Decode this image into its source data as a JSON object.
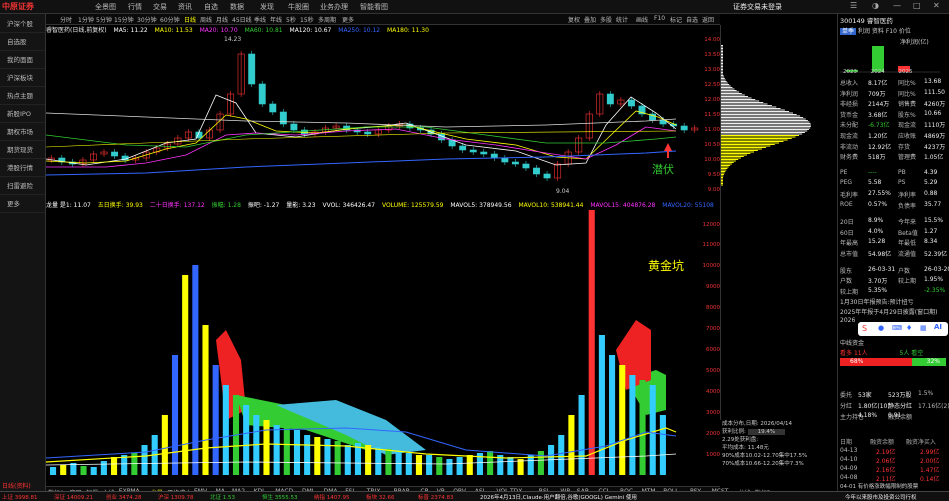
{
  "menubar": {
    "logo": "中原证券",
    "items": [
      "全景图",
      "行情",
      "交易",
      "资讯",
      "自选",
      "数据",
      "发现",
      "牛股圈",
      "业务办理",
      "智能看图"
    ],
    "right_text": "证券交易未登录"
  },
  "sidebar": {
    "items": [
      "沪深个股",
      "自选股",
      "我的面面",
      "沪深板块",
      "热点主题",
      "新股IPO",
      "期权市场",
      "期货现货",
      "港股行情",
      "扫雷避险",
      "更多"
    ]
  },
  "periods": {
    "items": [
      "分时",
      "1分钟",
      "5分钟",
      "15分钟",
      "30分钟",
      "60分钟",
      "日线",
      "周线",
      "月线",
      "45日线",
      "季线",
      "年线",
      "5秒",
      "15秒",
      "多周期",
      "更多"
    ],
    "active": "日线",
    "right": [
      "复权",
      "叠加",
      "多股",
      "统计",
      "画线",
      "F10",
      "标记",
      "自选",
      "返回"
    ]
  },
  "ma_line": {
    "name": "睿智医药(日线,前复权)",
    "items": [
      {
        "t": "MA5: 11.22",
        "c": "#fff"
      },
      {
        "t": "MA10: 11.53",
        "c": "#ff0"
      },
      {
        "t": "MA20: 10.70",
        "c": "#f3f"
      },
      {
        "t": "MA60: 10.81",
        "c": "#3c3"
      },
      {
        "t": "MA120: 10.67",
        "c": "#fff"
      },
      {
        "t": "MA250: 10.12",
        "c": "#36f"
      },
      {
        "t": "MA180: 11.30",
        "c": "#ff0"
      }
    ]
  },
  "chart_labels": {
    "high": "14.23",
    "low": "9.04",
    "tag": "潜伏",
    "tag2": "黄金坑"
  },
  "yaxis": [
    "14.00",
    "13.50",
    "13.00",
    "12.50",
    "12.00",
    "11.50",
    "11.00",
    "10.50",
    "10.00",
    "9.50",
    "9.00"
  ],
  "vol_line": {
    "items": [
      {
        "t": "龙量 是1: 11.07",
        "c": "#fff"
      },
      {
        "t": "五日换手: 39.93",
        "c": "#ff0"
      },
      {
        "t": "二十日换手: 137.12",
        "c": "#f3f"
      },
      {
        "t": "振幅: 1.28",
        "c": "#3c3"
      },
      {
        "t": "振吧: -1.27",
        "c": "#fff"
      },
      {
        "t": "量能: 3.23",
        "c": "#fff"
      },
      {
        "t": "VVOL: 346426.47",
        "c": "#fff"
      },
      {
        "t": "VOLUME: 125579.59",
        "c": "#ff0"
      },
      {
        "t": "MAVOL5: 378949.56",
        "c": "#fff"
      },
      {
        "t": "MAVOL10: 538941.44",
        "c": "#ff0"
      },
      {
        "t": "MAVOL15: 404876.28",
        "c": "#f3f"
      },
      {
        "t": "MAVOL20: 55108",
        "c": "#36f"
      }
    ]
  },
  "vyaxis": [
    "12000",
    "11000",
    "10000",
    "9000",
    "8000",
    "7000",
    "6000",
    "5000",
    "4000",
    "3000",
    "2000",
    "1000"
  ],
  "ind_tabs": [
    "指标A",
    "窗口",
    "起爆",
    "主线",
    "EXPMA",
    "龙量",
    "平均成本",
    "EMV",
    "MA",
    "MA2",
    "KDJ",
    "MACD",
    "DMI",
    "DMA",
    "FSL",
    "TRIX",
    "BRAR",
    "CR",
    "VR",
    "OBV",
    "ASI",
    "VOL-TDX",
    "RSI",
    "WR",
    "SAR",
    "CCI",
    "ROC",
    "MTM",
    "BOLL",
    "PSY",
    "MCST",
    "龙线",
    "指标B"
  ],
  "dist_info": {
    "title": "成本分布,日期: 2026/04/14",
    "profit": "获利比例:",
    "profit_val": "19.4%",
    "ratio": "2.29处获利盘:",
    "avg": "平均成本: 11.48元",
    "r90": "90%成本10.02-12.70集中17.5%",
    "r70": "70%成本10.66-12.20集中7.3%"
  },
  "quote": {
    "code": "300149",
    "name": "睿智医药",
    "tabs": [
      "单季",
      "利润",
      "资料",
      "F10",
      "价位"
    ],
    "fin_title": "净利润(亿)",
    "years": [
      "2023",
      "2024",
      "2025"
    ],
    "rows": [
      [
        "总收入",
        "8.17亿",
        "同比%",
        "13.68"
      ],
      [
        "净利润",
        "709万",
        "同比%",
        "111.50"
      ],
      [
        "非经损",
        "2144万",
        "销售费",
        "4260万"
      ],
      [
        "货币金",
        "3.68亿",
        "股东%",
        "10.66"
      ],
      [
        "未分配",
        "-6.73亿",
        "现金流",
        "1110万"
      ],
      [
        "现金流",
        "1.20亿",
        "应收账",
        "4869万"
      ],
      [
        "非流动",
        "12.92亿",
        "存货",
        "4237万"
      ],
      [
        "财务费",
        "518万",
        "管理费",
        "1.05亿"
      ],
      [
        "PE",
        "----",
        "PB",
        "4.39"
      ],
      [
        "PEG",
        "5.58",
        "PS",
        "5.29"
      ],
      [
        "毛利率",
        "27.55%",
        "净利率",
        "0.88"
      ],
      [
        "ROE",
        "0.57%",
        "负债率",
        "35.77"
      ],
      [
        "20日",
        "8.9%",
        "今年来",
        "15.5%"
      ],
      [
        "60日",
        "4.0%",
        "Beta值",
        "1.27"
      ],
      [
        "年最高",
        "15.28",
        "年最低",
        "8.34"
      ],
      [
        "总市值",
        "54.98亿",
        "流通值",
        "52.39亿"
      ],
      [
        "股东",
        "26-03-31",
        "户数",
        "26-03-20"
      ],
      [
        "户数",
        "3.70万",
        "较上期",
        "1.95%"
      ],
      [
        "较上期",
        "5.35%",
        "",
        "-2.35%"
      ]
    ],
    "news": [
      "1月30日年报预告:预计扭亏",
      "2025年年报于4月29日披露(窗口期)",
      "2026"
    ],
    "news_short": "中线资金",
    "sentiment": {
      "up_label": "看多",
      "up_count": "11人",
      "down_label": "看空",
      "down_count": "5人",
      "up_pct": "68%",
      "down_pct": "32%"
    },
    "misc": [
      [
        "委托",
        "53家",
        "",
        "523万股",
        "1.5%"
      ],
      [
        "分红",
        "1.80亿(10)",
        "",
        "静态分红",
        "17.16亿(2)"
      ],
      [
        "主力持仓",
        "4.18%",
        "融资余额",
        "0.91"
      ]
    ],
    "rongzi_header": [
      "日期",
      "融资余额",
      "融资净买入"
    ],
    "rongzi": [
      [
        "04-13",
        "2.19亿",
        "2.99亿"
      ],
      [
        "04-10",
        "2.06亿",
        "2.00亿"
      ],
      [
        "04-09",
        "2.16亿",
        "1.47亿"
      ],
      [
        "04-08",
        "2.11亿",
        "0.14亿"
      ]
    ],
    "bottom": [
      "中线资金",
      "主力资金",
      "北向"
    ],
    "last_news": "04-01 有价格涨跌幅限制的股票"
  },
  "bottom_tabs": [
    "日线(资料)",
    "关联报价"
  ],
  "statusbar": {
    "items": [
      {
        "t": "上证 3998.81",
        "c": "#f33"
      },
      {
        "t": "深证 14009.21",
        "c": "#f33"
      },
      {
        "t": "创业 3474.28",
        "c": "#f33"
      },
      {
        "t": "沪深 1309.78",
        "c": "#f33"
      },
      {
        "t": "北证 1.53",
        "c": "#3c3"
      },
      {
        "t": "恒生 3555.53",
        "c": "#3c3"
      },
      {
        "t": "纳指 1407.95",
        "c": "#f33"
      },
      {
        "t": "板块 32.66",
        "c": "#f33"
      },
      {
        "t": "标普 2374.83",
        "c": "#f33"
      }
    ],
    "ticker": "2026年4月13日,Claude·用户翻倍,谷歌(GOOGL) Gemini 使用",
    "right": "今年以来股市及投资公司行权"
  }
}
